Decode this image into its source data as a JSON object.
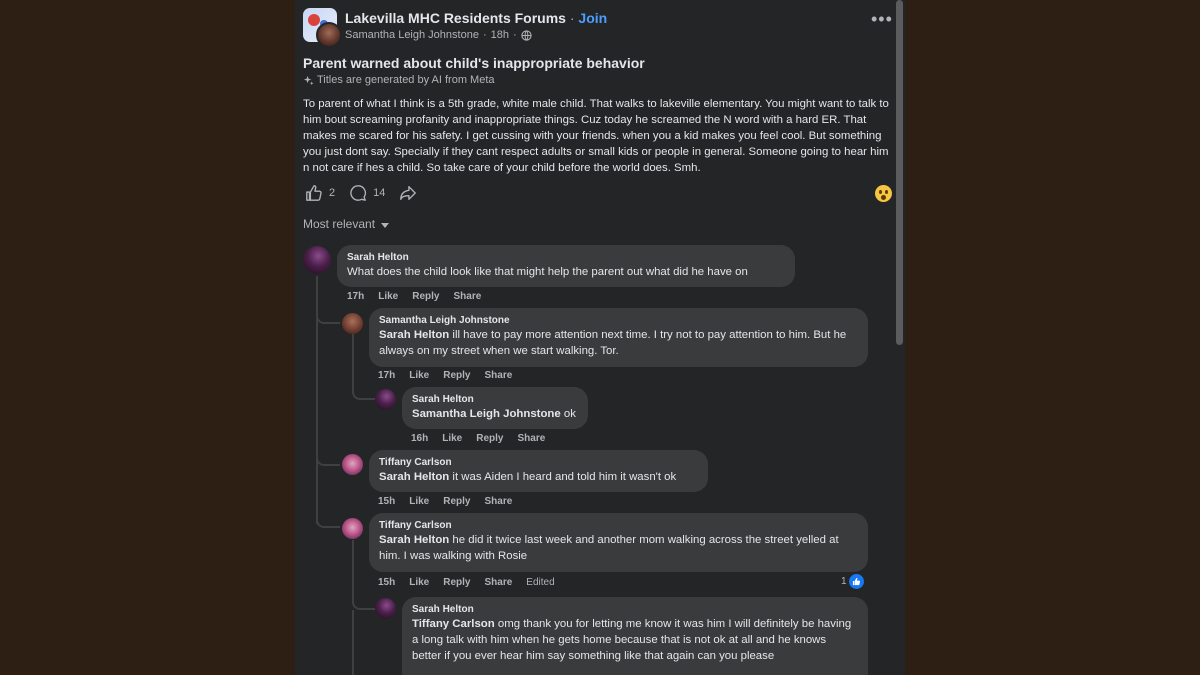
{
  "post": {
    "group_name": "Lakevilla MHC Residents Forums",
    "separator": "·",
    "join_label": "Join",
    "author": "Samantha Leigh Johnstone",
    "time": "18h",
    "title": "Parent warned about child's inappropriate behavior",
    "ai_note": "Titles are generated by AI from Meta",
    "body": "To parent of what I think is a 5th grade, white male child. That walks to lakeville elementary.  You might want to talk to him bout screaming profanity and inappropriate things. Cuz today he screamed the N word with a hard ER. That makes me scared for his safety.  I get cussing with your friends. when you a kid makes you feel cool. But something you just dont say. Specially if they cant respect adults or small kids or people in general. Someone going to hear him n not care if hes a child. So take care of your child before the world does. Smh.",
    "like_count": "2",
    "comment_count": "14",
    "reaction_icon": "wow-emoji-icon"
  },
  "sort_label": "Most relevant",
  "labels": {
    "like": "Like",
    "reply": "Reply",
    "share": "Share",
    "edited": "Edited"
  },
  "comments": [
    {
      "name": "Sarah Helton",
      "mention": "",
      "text": "What does the child look like that might help the parent out what did he have on",
      "time": "17h"
    },
    {
      "name": "Samantha Leigh Johnstone",
      "mention": "Sarah Helton",
      "text": " ill have to pay more attention next time. I try not to pay attention to him. But he always on my street when we start walking. Tor.",
      "time": "17h"
    },
    {
      "name": "Sarah Helton",
      "mention": "Samantha Leigh Johnstone",
      "text": " ok",
      "time": "16h"
    },
    {
      "name": "Tiffany Carlson",
      "mention": "Sarah Helton",
      "text": " it was Aiden I heard and told him it wasn't ok",
      "time": "15h"
    },
    {
      "name": "Tiffany Carlson",
      "mention": "Sarah Helton",
      "text": " he did it twice last week and another mom walking across the street yelled at him. I was walking with Rosie",
      "time": "15h",
      "reaction_count": "1"
    },
    {
      "name": "Sarah Helton",
      "mention": "Tiffany Carlson",
      "text": " omg thank you for letting me know it was him I will definitely be having a long talk with him when he gets home because that is not ok at all and he knows better if you ever hear him say something like that again can you please",
      "time": ""
    }
  ]
}
